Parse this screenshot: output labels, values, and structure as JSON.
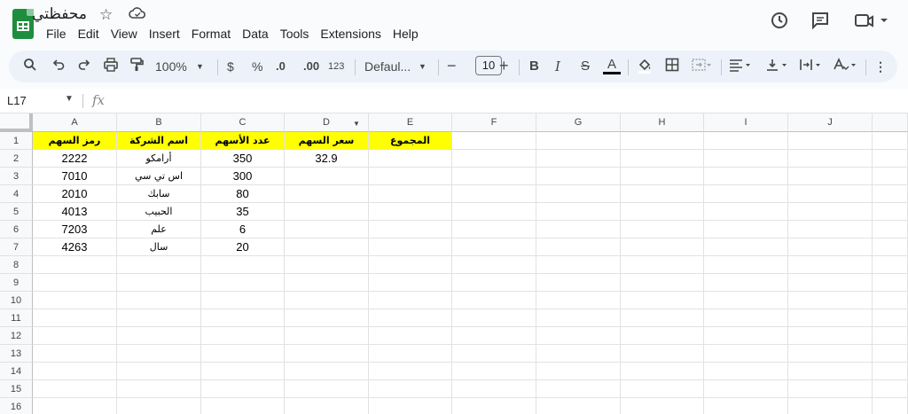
{
  "app": {
    "doc_title": "محفظتي",
    "menus": [
      "File",
      "Edit",
      "View",
      "Insert",
      "Format",
      "Data",
      "Tools",
      "Extensions",
      "Help"
    ]
  },
  "toolbar": {
    "zoom": "100%",
    "currency": "$",
    "percent": "%",
    "dec_decrease": ".0",
    "dec_increase": ".00",
    "number_format": "123",
    "font": "Defaul...",
    "font_size": "10",
    "bold": "B",
    "italic": "I",
    "strike": "S",
    "text_color": "A"
  },
  "formula_bar": {
    "cell_ref": "L17",
    "fx": "fx",
    "value": ""
  },
  "sheet": {
    "columns": [
      "A",
      "B",
      "C",
      "D",
      "E",
      "F",
      "G",
      "H",
      "I",
      "J"
    ],
    "rows": [
      "1",
      "2",
      "3",
      "4",
      "5",
      "6",
      "7",
      "8",
      "9",
      "10",
      "11",
      "12",
      "13",
      "14",
      "15",
      "16"
    ],
    "header_row": [
      "رمز السهم",
      "اسم الشركة",
      "عدد الأسهم",
      "سعر السهم",
      "المجموع"
    ],
    "data": [
      [
        "2222",
        "أرامكو",
        "350",
        "32.9",
        ""
      ],
      [
        "7010",
        "اس تي سي",
        "300",
        "",
        ""
      ],
      [
        "2010",
        "سابك",
        "80",
        "",
        ""
      ],
      [
        "4013",
        "الحبيب",
        "35",
        "",
        ""
      ],
      [
        "7203",
        "علم",
        "6",
        "",
        ""
      ],
      [
        "4263",
        "سال",
        "20",
        "",
        ""
      ]
    ],
    "highlight_color": "#ffff00"
  }
}
